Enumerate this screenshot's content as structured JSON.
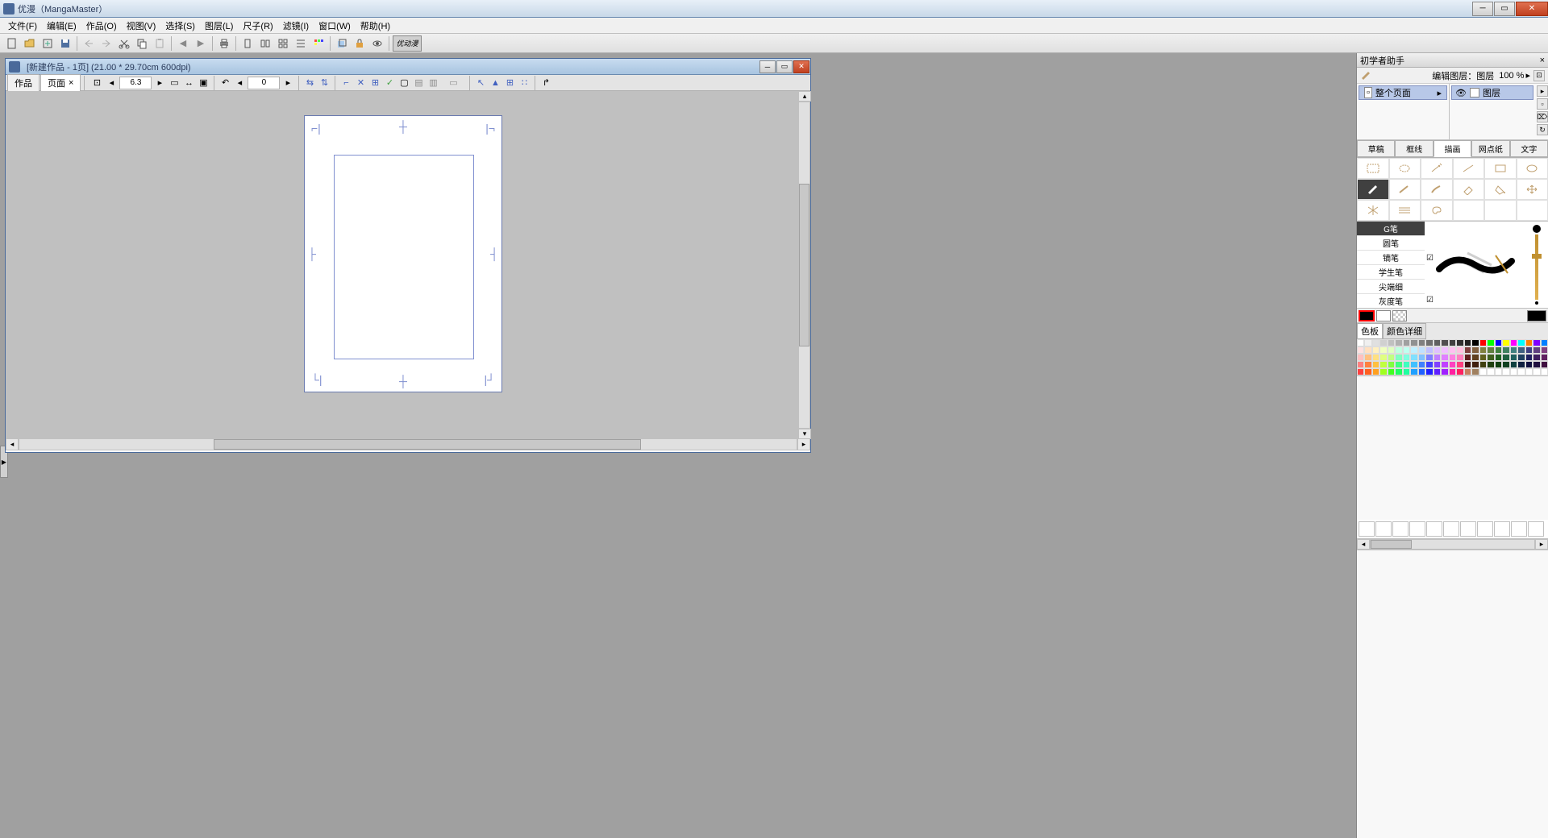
{
  "app": {
    "title": "优漫（MangaMaster）"
  },
  "menu": {
    "items": [
      "文件(F)",
      "编辑(E)",
      "作品(O)",
      "视图(V)",
      "选择(S)",
      "图层(L)",
      "尺子(R)",
      "滤镜(I)",
      "窗口(W)",
      "帮助(H)"
    ]
  },
  "document": {
    "title": "[新建作品 - 1页] (21.00 * 29.70cm 600dpi)",
    "tabs": [
      "作品",
      "页面"
    ],
    "active_tab": 1,
    "zoom": "6.3",
    "rotation": "0"
  },
  "side": {
    "assistant_title": "初学者助手",
    "edit_layer_label": "编辑图层：",
    "layer_name": "图层",
    "opacity": "100 %",
    "page_structure": "整个页面",
    "current_layer": "图层",
    "categories": [
      "草稿",
      "框线",
      "描画",
      "网点纸",
      "文字"
    ],
    "active_category": 2,
    "brushes": [
      "G笔",
      "圆笔",
      "镝笔",
      "学生笔",
      "尖端细",
      "灰度笔"
    ],
    "active_brush": 0,
    "palette_tabs": [
      "色板",
      "颜色详细"
    ]
  },
  "palette_colors": [
    "#ffffff",
    "#f0f0f0",
    "#e0e0e0",
    "#d0d0d0",
    "#c0c0c0",
    "#b0b0b0",
    "#a0a0a0",
    "#909090",
    "#808080",
    "#707070",
    "#606060",
    "#505050",
    "#404040",
    "#303030",
    "#202020",
    "#000000",
    "#ff0000",
    "#00ff00",
    "#0000ff",
    "#ffff00",
    "#ff00ff",
    "#00ffff",
    "#ff8000",
    "#8000ff",
    "#0080ff",
    "#ffe0e0",
    "#ffe0c0",
    "#fff0c0",
    "#f0ffc0",
    "#e0ffc0",
    "#c0ffe0",
    "#c0fff0",
    "#c0f0ff",
    "#c0e0ff",
    "#c0c0ff",
    "#e0c0ff",
    "#f0c0ff",
    "#ffc0f0",
    "#ffc0e0",
    "#804040",
    "#806040",
    "#808040",
    "#608040",
    "#408040",
    "#408060",
    "#408080",
    "#406080",
    "#404080",
    "#604080",
    "#804080",
    "#ffc0c0",
    "#ffc080",
    "#ffe080",
    "#e0ff80",
    "#c0ff80",
    "#80ffc0",
    "#80ffe0",
    "#80e0ff",
    "#80c0ff",
    "#8080ff",
    "#c080ff",
    "#e080ff",
    "#ff80e0",
    "#ff80c0",
    "#602020",
    "#604020",
    "#606020",
    "#406020",
    "#206020",
    "#206040",
    "#206060",
    "#204060",
    "#202060",
    "#402060",
    "#602060",
    "#ff8080",
    "#ff8040",
    "#ffc040",
    "#c0ff40",
    "#80ff40",
    "#40ff80",
    "#40ffc0",
    "#40c0ff",
    "#4080ff",
    "#4040ff",
    "#8040ff",
    "#c040ff",
    "#ff40c0",
    "#ff4080",
    "#401010",
    "#402010",
    "#404010",
    "#204010",
    "#104010",
    "#104020",
    "#104040",
    "#102040",
    "#101040",
    "#201040",
    "#401040",
    "#ff4040",
    "#ff6020",
    "#ffa020",
    "#a0ff20",
    "#40ff20",
    "#20ff60",
    "#20ffa0",
    "#20a0ff",
    "#2060ff",
    "#2020ff",
    "#6020ff",
    "#a020ff",
    "#ff20a0",
    "#ff2060",
    "#c88060",
    "#a08060",
    "",
    "",
    "",
    "",
    "",
    "",
    "",
    "",
    ""
  ]
}
